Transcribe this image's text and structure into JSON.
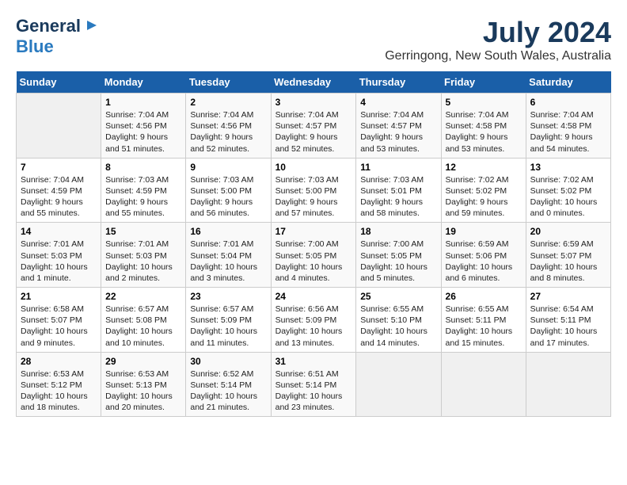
{
  "logo": {
    "general": "General",
    "blue": "Blue"
  },
  "header": {
    "month_year": "July 2024",
    "location": "Gerringong, New South Wales, Australia"
  },
  "days_of_week": [
    "Sunday",
    "Monday",
    "Tuesday",
    "Wednesday",
    "Thursday",
    "Friday",
    "Saturday"
  ],
  "weeks": [
    [
      {
        "num": "",
        "info": ""
      },
      {
        "num": "1",
        "info": "Sunrise: 7:04 AM\nSunset: 4:56 PM\nDaylight: 9 hours\nand 51 minutes."
      },
      {
        "num": "2",
        "info": "Sunrise: 7:04 AM\nSunset: 4:56 PM\nDaylight: 9 hours\nand 52 minutes."
      },
      {
        "num": "3",
        "info": "Sunrise: 7:04 AM\nSunset: 4:57 PM\nDaylight: 9 hours\nand 52 minutes."
      },
      {
        "num": "4",
        "info": "Sunrise: 7:04 AM\nSunset: 4:57 PM\nDaylight: 9 hours\nand 53 minutes."
      },
      {
        "num": "5",
        "info": "Sunrise: 7:04 AM\nSunset: 4:58 PM\nDaylight: 9 hours\nand 53 minutes."
      },
      {
        "num": "6",
        "info": "Sunrise: 7:04 AM\nSunset: 4:58 PM\nDaylight: 9 hours\nand 54 minutes."
      }
    ],
    [
      {
        "num": "7",
        "info": "Sunrise: 7:04 AM\nSunset: 4:59 PM\nDaylight: 9 hours\nand 55 minutes."
      },
      {
        "num": "8",
        "info": "Sunrise: 7:03 AM\nSunset: 4:59 PM\nDaylight: 9 hours\nand 55 minutes."
      },
      {
        "num": "9",
        "info": "Sunrise: 7:03 AM\nSunset: 5:00 PM\nDaylight: 9 hours\nand 56 minutes."
      },
      {
        "num": "10",
        "info": "Sunrise: 7:03 AM\nSunset: 5:00 PM\nDaylight: 9 hours\nand 57 minutes."
      },
      {
        "num": "11",
        "info": "Sunrise: 7:03 AM\nSunset: 5:01 PM\nDaylight: 9 hours\nand 58 minutes."
      },
      {
        "num": "12",
        "info": "Sunrise: 7:02 AM\nSunset: 5:02 PM\nDaylight: 9 hours\nand 59 minutes."
      },
      {
        "num": "13",
        "info": "Sunrise: 7:02 AM\nSunset: 5:02 PM\nDaylight: 10 hours\nand 0 minutes."
      }
    ],
    [
      {
        "num": "14",
        "info": "Sunrise: 7:01 AM\nSunset: 5:03 PM\nDaylight: 10 hours\nand 1 minute."
      },
      {
        "num": "15",
        "info": "Sunrise: 7:01 AM\nSunset: 5:03 PM\nDaylight: 10 hours\nand 2 minutes."
      },
      {
        "num": "16",
        "info": "Sunrise: 7:01 AM\nSunset: 5:04 PM\nDaylight: 10 hours\nand 3 minutes."
      },
      {
        "num": "17",
        "info": "Sunrise: 7:00 AM\nSunset: 5:05 PM\nDaylight: 10 hours\nand 4 minutes."
      },
      {
        "num": "18",
        "info": "Sunrise: 7:00 AM\nSunset: 5:05 PM\nDaylight: 10 hours\nand 5 minutes."
      },
      {
        "num": "19",
        "info": "Sunrise: 6:59 AM\nSunset: 5:06 PM\nDaylight: 10 hours\nand 6 minutes."
      },
      {
        "num": "20",
        "info": "Sunrise: 6:59 AM\nSunset: 5:07 PM\nDaylight: 10 hours\nand 8 minutes."
      }
    ],
    [
      {
        "num": "21",
        "info": "Sunrise: 6:58 AM\nSunset: 5:07 PM\nDaylight: 10 hours\nand 9 minutes."
      },
      {
        "num": "22",
        "info": "Sunrise: 6:57 AM\nSunset: 5:08 PM\nDaylight: 10 hours\nand 10 minutes."
      },
      {
        "num": "23",
        "info": "Sunrise: 6:57 AM\nSunset: 5:09 PM\nDaylight: 10 hours\nand 11 minutes."
      },
      {
        "num": "24",
        "info": "Sunrise: 6:56 AM\nSunset: 5:09 PM\nDaylight: 10 hours\nand 13 minutes."
      },
      {
        "num": "25",
        "info": "Sunrise: 6:55 AM\nSunset: 5:10 PM\nDaylight: 10 hours\nand 14 minutes."
      },
      {
        "num": "26",
        "info": "Sunrise: 6:55 AM\nSunset: 5:11 PM\nDaylight: 10 hours\nand 15 minutes."
      },
      {
        "num": "27",
        "info": "Sunrise: 6:54 AM\nSunset: 5:11 PM\nDaylight: 10 hours\nand 17 minutes."
      }
    ],
    [
      {
        "num": "28",
        "info": "Sunrise: 6:53 AM\nSunset: 5:12 PM\nDaylight: 10 hours\nand 18 minutes."
      },
      {
        "num": "29",
        "info": "Sunrise: 6:53 AM\nSunset: 5:13 PM\nDaylight: 10 hours\nand 20 minutes."
      },
      {
        "num": "30",
        "info": "Sunrise: 6:52 AM\nSunset: 5:14 PM\nDaylight: 10 hours\nand 21 minutes."
      },
      {
        "num": "31",
        "info": "Sunrise: 6:51 AM\nSunset: 5:14 PM\nDaylight: 10 hours\nand 23 minutes."
      },
      {
        "num": "",
        "info": ""
      },
      {
        "num": "",
        "info": ""
      },
      {
        "num": "",
        "info": ""
      }
    ]
  ]
}
